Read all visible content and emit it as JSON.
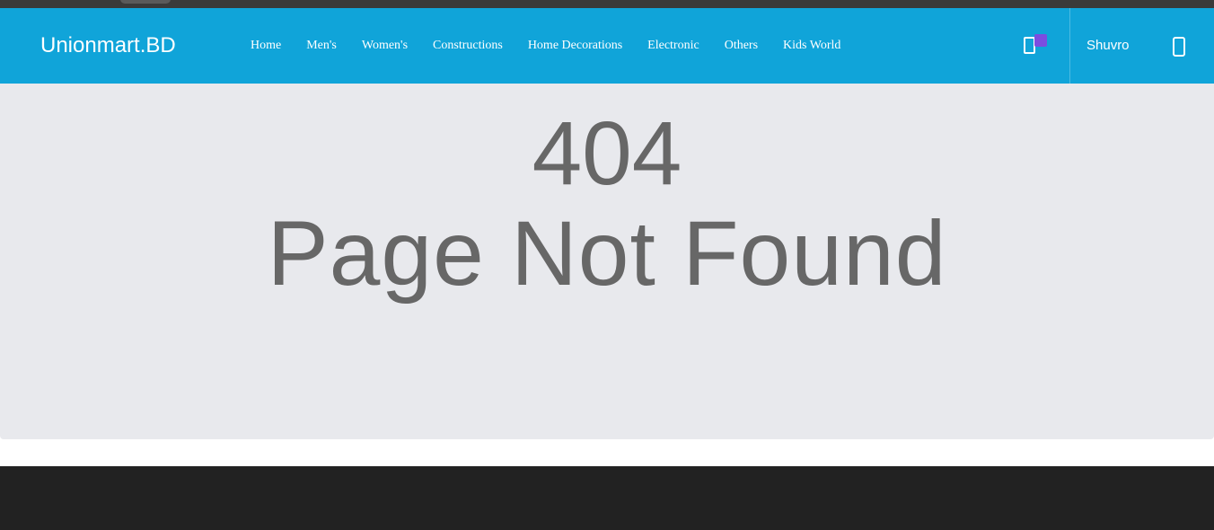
{
  "header": {
    "brand": "Unionmart.BD",
    "nav": [
      {
        "label": "Home"
      },
      {
        "label": "Men's"
      },
      {
        "label": "Women's"
      },
      {
        "label": "Constructions"
      },
      {
        "label": "Home Decorations"
      },
      {
        "label": "Electronic"
      },
      {
        "label": "Others"
      },
      {
        "label": "Kids World"
      }
    ],
    "user_name": "Shuvro",
    "cart_icon": "shopping-bag-icon",
    "user_icon": "mobile-icon"
  },
  "main": {
    "error_code": "404",
    "message": "Page Not Found"
  },
  "colors": {
    "navbar": "#10a4d9",
    "badge": "#7b4de0",
    "hero_bg": "#e8e9ed",
    "text": "#676767",
    "footer": "#222222"
  }
}
